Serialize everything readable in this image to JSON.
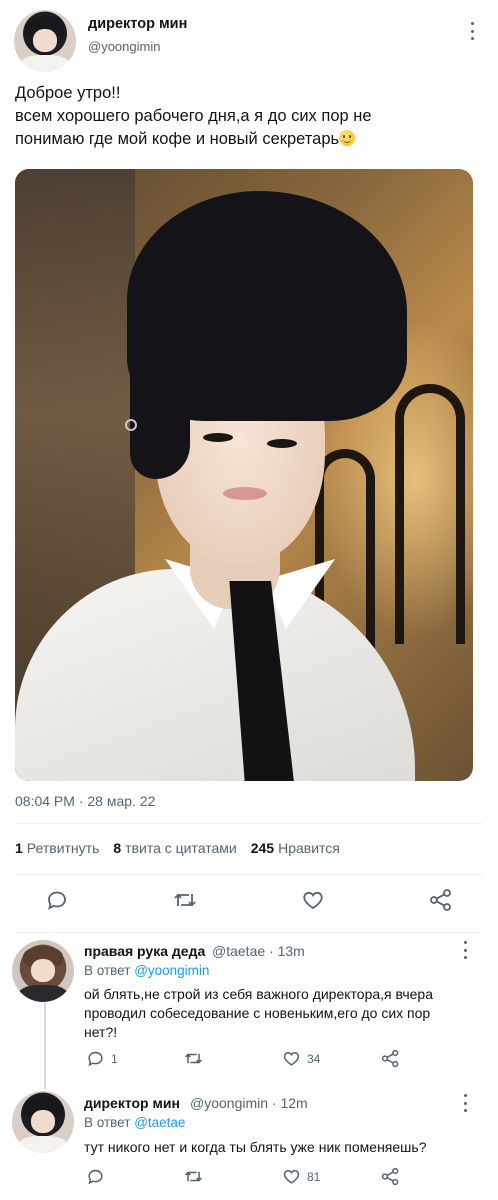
{
  "tweet": {
    "author_name": "директор мин",
    "author_handle": "@yoongimin",
    "text_lines": [
      "Доброе утро!!",
      "всем хорошего рабочего дня,а я до сих пор не",
      "понимаю где мой кофе и новый секретарь"
    ],
    "emoji_icon": "slightly-smiling-face-icon",
    "timestamp": "08:04 PM · 28 мар. 22",
    "stats": {
      "retweets_count": "1",
      "retweets_label": "Ретвитнуть",
      "quotes_count": "8",
      "quotes_label": "твита с цитатами",
      "likes_count": "245",
      "likes_label": "Нравится"
    },
    "actions": [
      "reply-icon",
      "retweet-icon",
      "like-icon",
      "share-icon"
    ]
  },
  "replies": [
    {
      "author_name": "правая рука деда",
      "author_handle": "@taetae",
      "time": "13m",
      "reply_prefix": "В ответ",
      "reply_to": "@yoongimin",
      "text_lines": [
        "ой блять,не строй из себя важного директора,я вчера",
        "проводил собеседование с новеньким,его до сих пор",
        "нет?!"
      ],
      "reply_count": "1",
      "retweet_count": "",
      "like_count": "34"
    },
    {
      "author_name": "директор мин",
      "author_handle": "@yoongimin",
      "time": "12m",
      "reply_prefix": "В ответ",
      "reply_to": "@taetae",
      "text_lines": [
        "тут никого нет и когда ты блять уже ник поменяешь?"
      ],
      "reply_count": "",
      "retweet_count": "",
      "like_count": "81"
    }
  ],
  "colors": {
    "text": "#0f1419",
    "secondary": "#536471",
    "link": "#1d9bf0",
    "divider": "#eff3f4"
  }
}
